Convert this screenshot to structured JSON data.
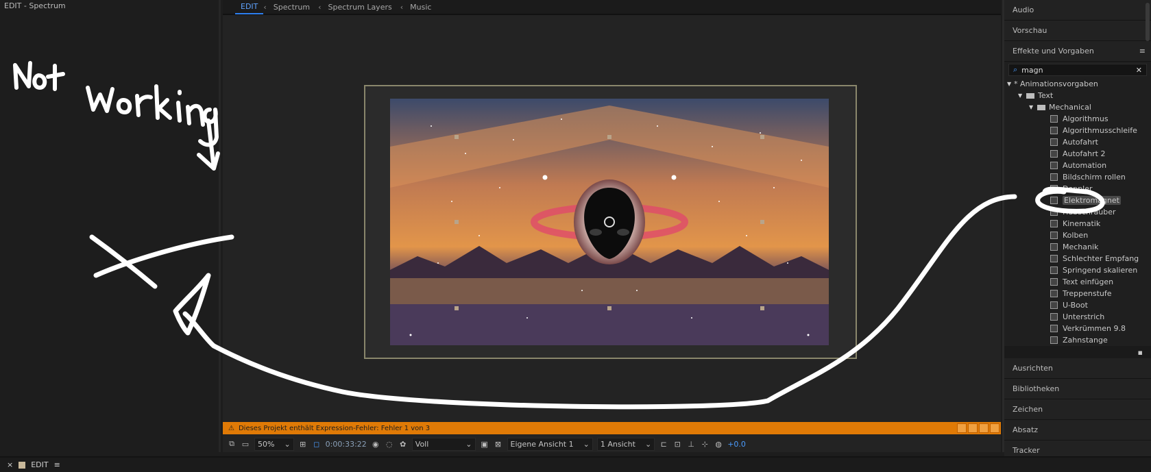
{
  "left_panel": {
    "header": "EDIT - Spectrum"
  },
  "annotation": {
    "handwritten": "Not working"
  },
  "breadcrumb": {
    "items": [
      "EDIT",
      "Spectrum",
      "Spectrum Layers",
      "Music"
    ]
  },
  "status_bar": {
    "message": "Dieses Projekt enthält Expression-Fehler: Fehler 1 von 3"
  },
  "viewer_toolbar": {
    "zoom": "50%",
    "timecode": "0:00:33:22",
    "resolution": "Voll",
    "view": "Eigene Ansicht 1",
    "views_count": "1 Ansicht",
    "exposure": "+0.0"
  },
  "right_panel": {
    "sections_top": [
      "Audio",
      "Vorschau"
    ],
    "effects_title": "Effekte und Vorgaben",
    "search_value": "magn",
    "tree": {
      "root": "* Animationsvorgaben",
      "folder1": "Text",
      "folder2": "Mechanical",
      "items": [
        "Algorithmus",
        "Algorithmusschleife",
        "Autofahrt",
        "Autofahrt 2",
        "Automation",
        "Bildschirm rollen",
        "Doppler",
        "Elektromagnet",
        "Hubschrauber",
        "Kinematik",
        "Kolben",
        "Mechanik",
        "Schlechter Empfang",
        "Springend skalieren",
        "Text einfügen",
        "Treppenstufe",
        "U-Boot",
        "Unterstrich",
        "Verkrümmen 9.8",
        "Zahnstange"
      ],
      "selected": "Elektromagnet"
    },
    "sections_bottom": [
      "Ausrichten",
      "Bibliotheken",
      "Zeichen",
      "Absatz",
      "Tracker"
    ]
  },
  "bottom_tab": {
    "label": "EDIT"
  }
}
